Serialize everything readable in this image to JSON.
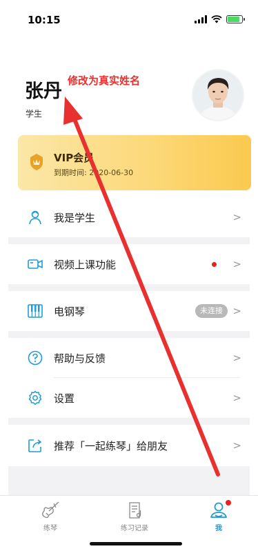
{
  "status_bar": {
    "time": "10:15",
    "battery_level": 0.85
  },
  "profile": {
    "name": "张丹",
    "role": "学生",
    "annotation": "修改为真实姓名"
  },
  "vip": {
    "title": "VIP会员",
    "expiry": "到期时间: 2020-06-30"
  },
  "menu": {
    "student": {
      "label": "我是学生",
      "icon": "student-icon"
    },
    "video": {
      "label": "视频上课功能",
      "icon": "video-camera-icon"
    },
    "piano": {
      "label": "电钢琴",
      "icon": "piano-keys-icon",
      "status": "未连接"
    },
    "help": {
      "label": "帮助与反馈",
      "icon": "help-icon"
    },
    "settings": {
      "label": "设置",
      "icon": "gear-icon"
    },
    "share": {
      "label": "推荐「一起练琴」给朋友",
      "icon": "share-icon"
    }
  },
  "tabs": [
    {
      "label": "练琴",
      "icon": "violin-icon",
      "active": false
    },
    {
      "label": "练习记录",
      "icon": "practice-record-icon",
      "active": false
    },
    {
      "label": "我",
      "icon": "profile-icon",
      "active": true
    }
  ],
  "colors": {
    "accent": "#1e9bd7",
    "annotation": "#e8312f",
    "badge_red": "#e8201e",
    "vip_gold": "#fcd97a"
  }
}
